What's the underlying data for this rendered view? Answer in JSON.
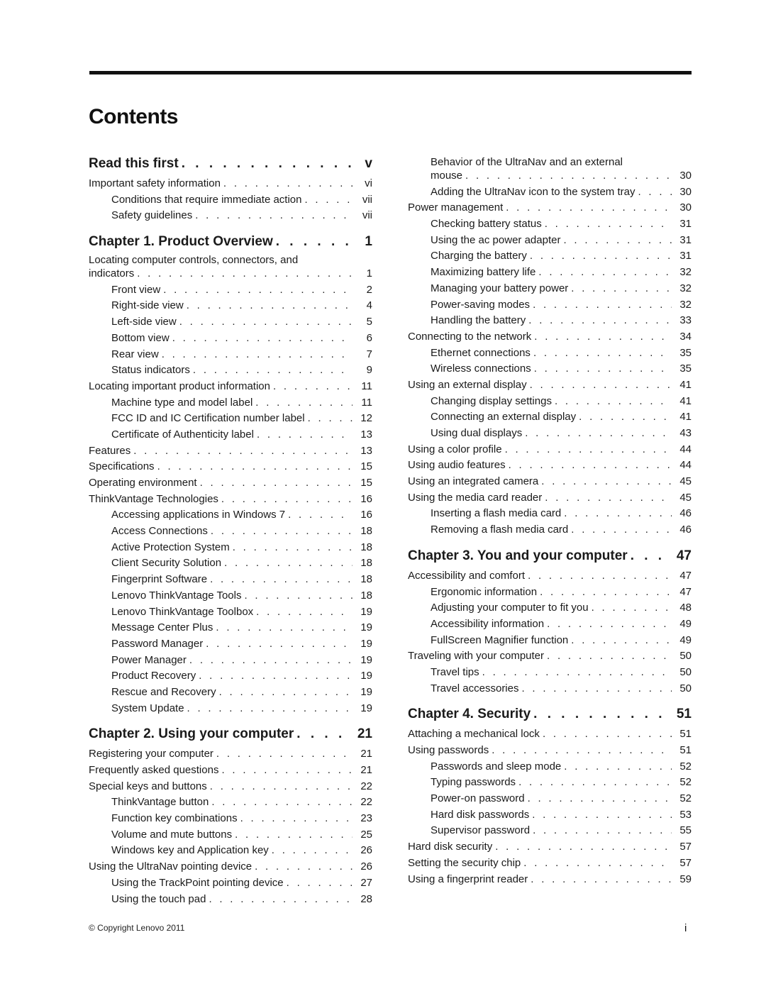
{
  "title": "Contents",
  "left_column": [
    {
      "type": "chapter",
      "label": "Read this first",
      "page": "v"
    },
    {
      "type": "section",
      "label": "Important safety information",
      "page": "vi"
    },
    {
      "type": "sub",
      "label": "Conditions that require immediate action",
      "page": "vii"
    },
    {
      "type": "sub",
      "label": "Safety guidelines",
      "page": "vii"
    },
    {
      "type": "chapter",
      "label": "Chapter 1. Product Overview",
      "page": "1"
    },
    {
      "type": "section",
      "label": "indicators",
      "wrap": "Locating computer controls, connectors, and",
      "page": "1"
    },
    {
      "type": "sub",
      "label": "Front view",
      "page": "2"
    },
    {
      "type": "sub",
      "label": "Right-side view",
      "page": "4"
    },
    {
      "type": "sub",
      "label": "Left-side view",
      "page": "5"
    },
    {
      "type": "sub",
      "label": "Bottom view",
      "page": "6"
    },
    {
      "type": "sub",
      "label": "Rear view",
      "page": "7"
    },
    {
      "type": "sub",
      "label": "Status indicators",
      "page": "9"
    },
    {
      "type": "section",
      "label": "Locating important product information",
      "page": "11"
    },
    {
      "type": "sub",
      "label": "Machine type and model label",
      "page": "11"
    },
    {
      "type": "sub",
      "label": "FCC ID and IC Certification number label",
      "page": "12"
    },
    {
      "type": "sub",
      "label": "Certificate of Authenticity label",
      "page": "13"
    },
    {
      "type": "section",
      "label": "Features",
      "page": "13"
    },
    {
      "type": "section",
      "label": "Specifications",
      "page": "15"
    },
    {
      "type": "section",
      "label": "Operating environment",
      "page": "15"
    },
    {
      "type": "section",
      "label": "ThinkVantage Technologies",
      "page": "16"
    },
    {
      "type": "sub",
      "label": "Accessing applications in Windows 7",
      "page": "16"
    },
    {
      "type": "sub",
      "label": "Access Connections",
      "page": "18"
    },
    {
      "type": "sub",
      "label": "Active Protection System",
      "page": "18"
    },
    {
      "type": "sub",
      "label": "Client Security Solution",
      "page": "18"
    },
    {
      "type": "sub",
      "label": "Fingerprint Software",
      "page": "18"
    },
    {
      "type": "sub",
      "label": "Lenovo ThinkVantage Tools",
      "page": "18"
    },
    {
      "type": "sub",
      "label": "Lenovo ThinkVantage Toolbox",
      "page": "19"
    },
    {
      "type": "sub",
      "label": "Message Center Plus",
      "page": "19"
    },
    {
      "type": "sub",
      "label": "Password Manager",
      "page": "19"
    },
    {
      "type": "sub",
      "label": "Power Manager",
      "page": "19"
    },
    {
      "type": "sub",
      "label": "Product Recovery",
      "page": "19"
    },
    {
      "type": "sub",
      "label": "Rescue and Recovery",
      "page": "19"
    },
    {
      "type": "sub",
      "label": "System Update",
      "page": "19"
    },
    {
      "type": "chapter",
      "label": "Chapter 2. Using your computer",
      "page": "21"
    },
    {
      "type": "section",
      "label": "Registering your computer",
      "page": "21"
    },
    {
      "type": "section",
      "label": "Frequently asked questions",
      "page": "21"
    },
    {
      "type": "section",
      "label": "Special keys and buttons",
      "page": "22"
    },
    {
      "type": "sub",
      "label": "ThinkVantage button",
      "page": "22"
    },
    {
      "type": "sub",
      "label": "Function key combinations",
      "page": "23"
    },
    {
      "type": "sub",
      "label": "Volume and mute buttons",
      "page": "25"
    },
    {
      "type": "sub",
      "label": "Windows key and Application key",
      "page": "26"
    },
    {
      "type": "section",
      "label": "Using the UltraNav pointing device",
      "page": "26"
    },
    {
      "type": "sub",
      "label": "Using the TrackPoint pointing device",
      "page": "27"
    },
    {
      "type": "sub",
      "label": "Using the touch pad",
      "page": "28"
    }
  ],
  "right_column": [
    {
      "type": "sub",
      "label": "mouse",
      "wrap": "Behavior of the UltraNav and an external",
      "page": "30"
    },
    {
      "type": "sub",
      "label": "Adding the UltraNav icon to the system tray",
      "page": "30"
    },
    {
      "type": "section",
      "label": "Power management",
      "page": "30"
    },
    {
      "type": "sub",
      "label": "Checking battery status",
      "page": "31"
    },
    {
      "type": "sub",
      "label": "Using the ac power adapter",
      "page": "31"
    },
    {
      "type": "sub",
      "label": "Charging the battery",
      "page": "31"
    },
    {
      "type": "sub",
      "label": "Maximizing battery life",
      "page": "32"
    },
    {
      "type": "sub",
      "label": "Managing your battery power",
      "page": "32"
    },
    {
      "type": "sub",
      "label": "Power-saving modes",
      "page": "32"
    },
    {
      "type": "sub",
      "label": "Handling the battery",
      "page": "33"
    },
    {
      "type": "section",
      "label": "Connecting to the network",
      "page": "34"
    },
    {
      "type": "sub",
      "label": "Ethernet connections",
      "page": "35"
    },
    {
      "type": "sub",
      "label": "Wireless connections",
      "page": "35"
    },
    {
      "type": "section",
      "label": "Using an external display",
      "page": "41"
    },
    {
      "type": "sub",
      "label": "Changing display settings",
      "page": "41"
    },
    {
      "type": "sub",
      "label": "Connecting an external display",
      "page": "41"
    },
    {
      "type": "sub",
      "label": "Using dual displays",
      "page": "43"
    },
    {
      "type": "section",
      "label": "Using a color profile",
      "page": "44"
    },
    {
      "type": "section",
      "label": "Using audio features",
      "page": "44"
    },
    {
      "type": "section",
      "label": "Using an integrated camera",
      "page": "45"
    },
    {
      "type": "section",
      "label": "Using the media card reader",
      "page": "45"
    },
    {
      "type": "sub",
      "label": "Inserting a flash media card",
      "page": "46"
    },
    {
      "type": "sub",
      "label": "Removing a flash media card",
      "page": "46"
    },
    {
      "type": "chapter",
      "label": "Chapter 3. You and your computer",
      "page": "47"
    },
    {
      "type": "section",
      "label": "Accessibility and comfort",
      "page": "47"
    },
    {
      "type": "sub",
      "label": "Ergonomic information",
      "page": "47"
    },
    {
      "type": "sub",
      "label": "Adjusting your computer to fit you",
      "page": "48"
    },
    {
      "type": "sub",
      "label": "Accessibility information",
      "page": "49"
    },
    {
      "type": "sub",
      "label": "FullScreen Magnifier function",
      "page": "49"
    },
    {
      "type": "section",
      "label": "Traveling with your computer",
      "page": "50"
    },
    {
      "type": "sub",
      "label": "Travel tips",
      "page": "50"
    },
    {
      "type": "sub",
      "label": "Travel accessories",
      "page": "50"
    },
    {
      "type": "chapter",
      "label": "Chapter 4. Security",
      "page": "51"
    },
    {
      "type": "section",
      "label": "Attaching a mechanical lock",
      "page": "51"
    },
    {
      "type": "section",
      "label": "Using passwords",
      "page": "51"
    },
    {
      "type": "sub",
      "label": "Passwords and sleep mode",
      "page": "52"
    },
    {
      "type": "sub",
      "label": "Typing passwords",
      "page": "52"
    },
    {
      "type": "sub",
      "label": "Power-on password",
      "page": "52"
    },
    {
      "type": "sub",
      "label": "Hard disk passwords",
      "page": "53"
    },
    {
      "type": "sub",
      "label": "Supervisor password",
      "page": "55"
    },
    {
      "type": "section",
      "label": "Hard disk security",
      "page": "57"
    },
    {
      "type": "section",
      "label": "Setting the security chip",
      "page": "57"
    },
    {
      "type": "section",
      "label": "Using a fingerprint reader",
      "page": "59"
    }
  ],
  "footer": {
    "copyright": "© Copyright Lenovo 2011",
    "page_number": "i"
  }
}
